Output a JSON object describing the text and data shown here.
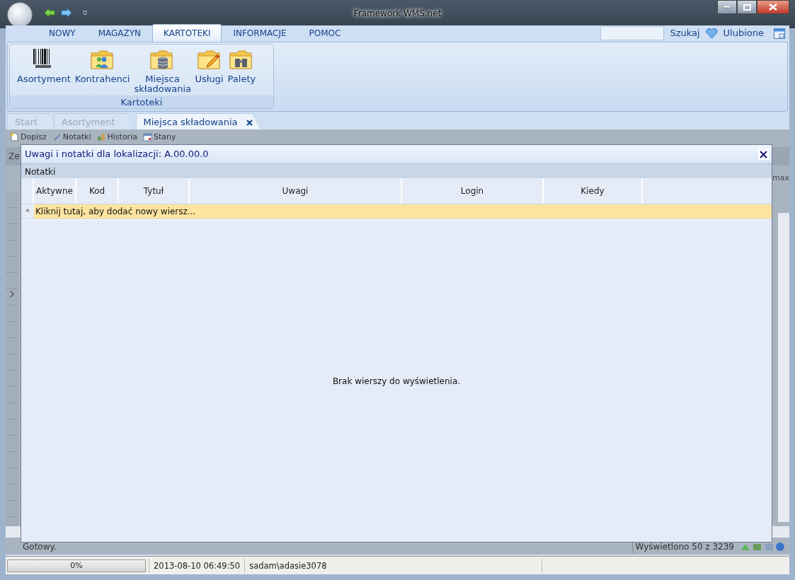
{
  "window": {
    "title": "Framework WMS.net"
  },
  "ribbon_tabs": [
    {
      "label": "NOWY",
      "selected": false
    },
    {
      "label": "MAGAZYN",
      "selected": false
    },
    {
      "label": "KARTOTEKI",
      "selected": true
    },
    {
      "label": "INFORMACJE",
      "selected": false
    },
    {
      "label": "POMOC",
      "selected": false
    }
  ],
  "search_button": "Szukaj",
  "favorites": "Ulubione",
  "ribbon_group": {
    "label": "Kartoteki",
    "items": [
      {
        "label": "Asortyment",
        "kind": "barcode"
      },
      {
        "label": "Kontrahenci",
        "kind": "people"
      },
      {
        "label": "Miejsca składowania",
        "kind": "database"
      },
      {
        "label": "Usługi",
        "kind": "pencil"
      },
      {
        "label": "Palety",
        "kind": "binoculars"
      }
    ]
  },
  "doc_tabs": [
    {
      "label": "Start",
      "selected": false,
      "closable": false
    },
    {
      "label": "Asortyment",
      "selected": false,
      "closable": false
    },
    {
      "label": "Miejsca składowania",
      "selected": true,
      "closable": true
    }
  ],
  "toolbar": [
    "Dopisz",
    "Notatki",
    "Historia",
    "Stany"
  ],
  "background_grid": {
    "column_1": "Ze",
    "column_2": "max"
  },
  "status": "Gotowy.",
  "record_count": "Wyświetlono 50 z 3239",
  "dialog": {
    "title": "Uwagi i notatki dla lokalizacji: A.00.00.0",
    "section": "Notatki",
    "columns": [
      "Aktywne",
      "Kod",
      "Tytuł",
      "Uwagi",
      "Login",
      "Kiedy"
    ],
    "new_row_marker": "*",
    "new_row": "Kliknij tutaj, aby dodać nowy wiersz...",
    "empty": "Brak wierszy do wyświetlenia."
  },
  "status_bar": {
    "progress": {
      "level": 0,
      "reading": "0%"
    },
    "datetime": "2013-08-10 06:49:50",
    "user": "sadam\\adasie3078"
  }
}
